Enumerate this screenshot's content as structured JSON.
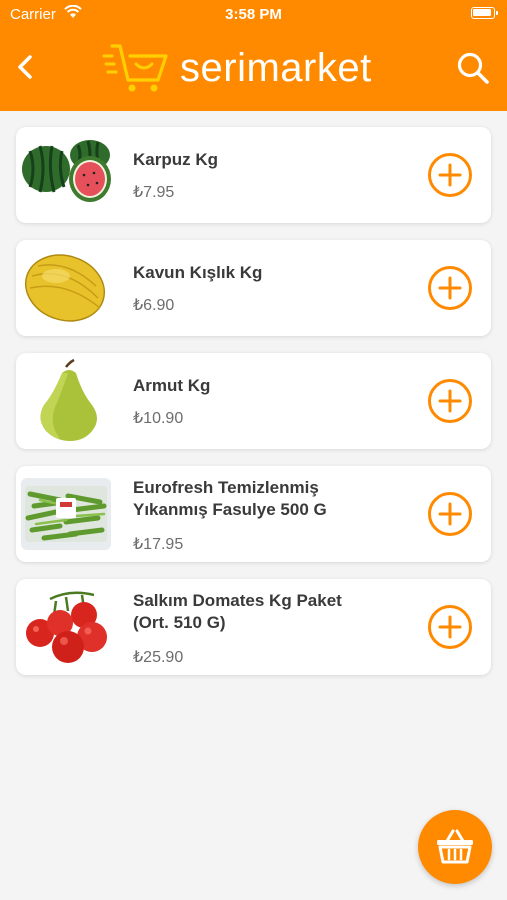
{
  "status_bar": {
    "carrier": "Carrier",
    "time": "3:58 PM"
  },
  "header": {
    "brand": "serimarket",
    "back_icon": "chevron-left-icon",
    "search_icon": "search-icon"
  },
  "colors": {
    "accent": "#ff8a00",
    "background": "#f4f4f4",
    "card": "#ffffff",
    "text": "#3a3a3a",
    "price": "#6d6d6d"
  },
  "products": [
    {
      "name": "Karpuz Kg",
      "price": "₺7.95",
      "image": "watermelon"
    },
    {
      "name": "Kavun Kışlık Kg",
      "price": "₺6.90",
      "image": "melon"
    },
    {
      "name": "Armut Kg",
      "price": "₺10.90",
      "image": "pear"
    },
    {
      "name_line1": "Eurofresh Temizlenmiş",
      "name_line2": "Yıkanmış Fasulye 500 G",
      "price": "₺17.95",
      "image": "green-beans"
    },
    {
      "name_line1": "Salkım Domates Kg Paket",
      "name_line2": "(Ort. 510 G)",
      "price": "₺25.90",
      "image": "tomatoes"
    }
  ],
  "fab": {
    "icon": "basket-icon"
  }
}
